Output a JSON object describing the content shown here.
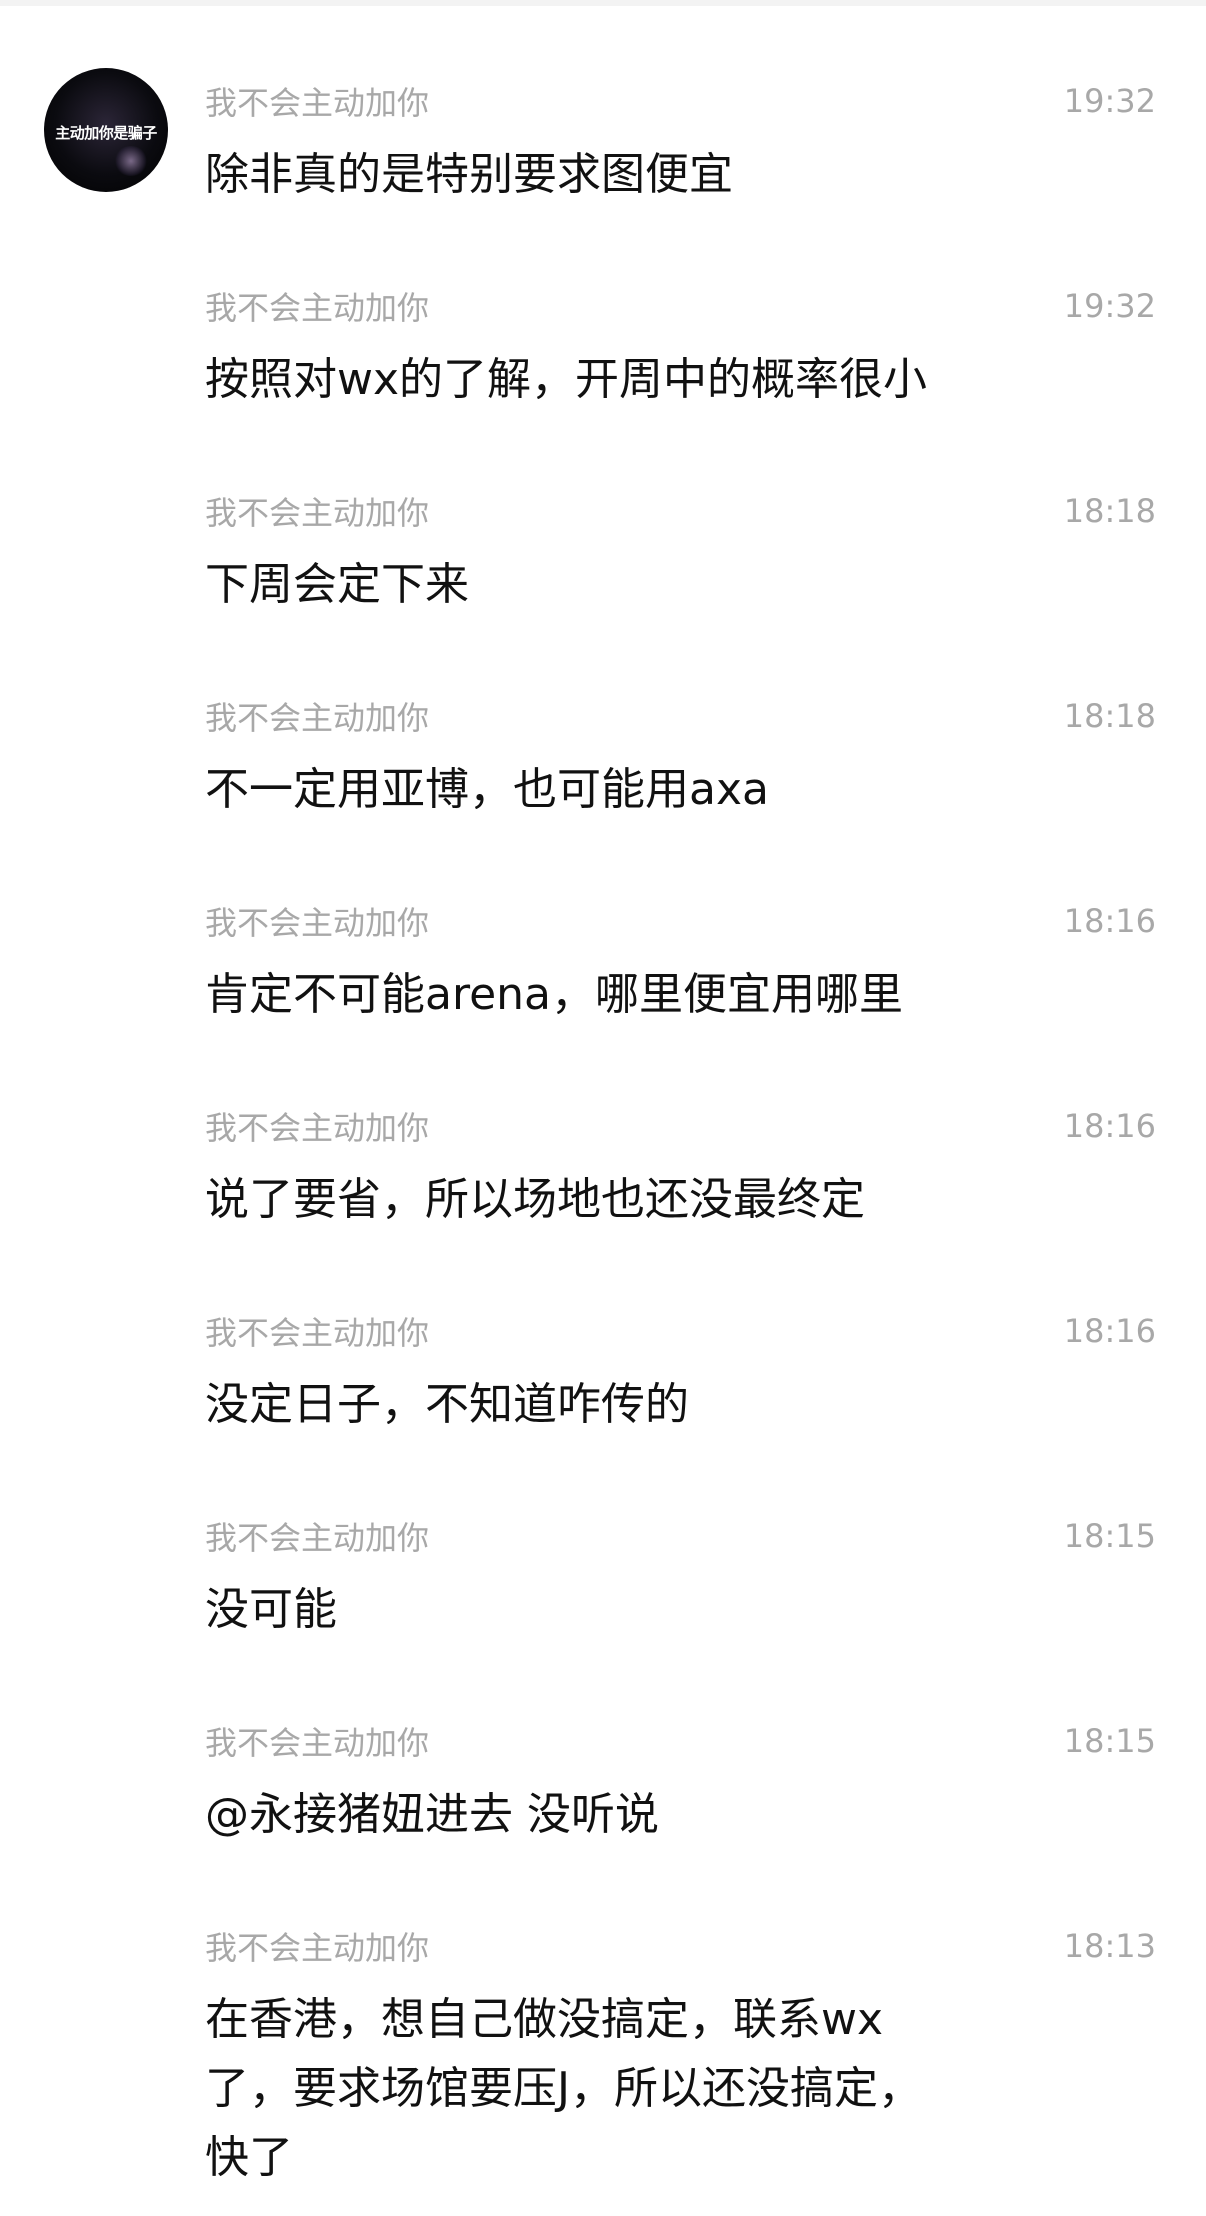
{
  "avatar": {
    "text": "主动加你是骗子"
  },
  "messages": [
    {
      "sender": "我不会主动加你",
      "time": "19:32",
      "text": "除非真的是特别要求图便宜"
    },
    {
      "sender": "我不会主动加你",
      "time": "19:32",
      "text": "按照对wx的了解，开周中的概率很小"
    },
    {
      "sender": "我不会主动加你",
      "time": "18:18",
      "text": "下周会定下来"
    },
    {
      "sender": "我不会主动加你",
      "time": "18:18",
      "text": "不一定用亚博，也可能用axa"
    },
    {
      "sender": "我不会主动加你",
      "time": "18:16",
      "text": "肯定不可能arena，哪里便宜用哪里"
    },
    {
      "sender": "我不会主动加你",
      "time": "18:16",
      "text": "说了要省，所以场地也还没最终定"
    },
    {
      "sender": "我不会主动加你",
      "time": "18:16",
      "text": "没定日子，不知道咋传的"
    },
    {
      "sender": "我不会主动加你",
      "time": "18:15",
      "text": "没可能"
    },
    {
      "sender": "我不会主动加你",
      "time": "18:15",
      "text": "@永接猪妞进去 没听说"
    },
    {
      "sender": "我不会主动加你",
      "time": "18:13",
      "text": "在香港，想自己做没搞定，联系wx了，要求场馆要压J，所以还没搞定，快了"
    }
  ]
}
